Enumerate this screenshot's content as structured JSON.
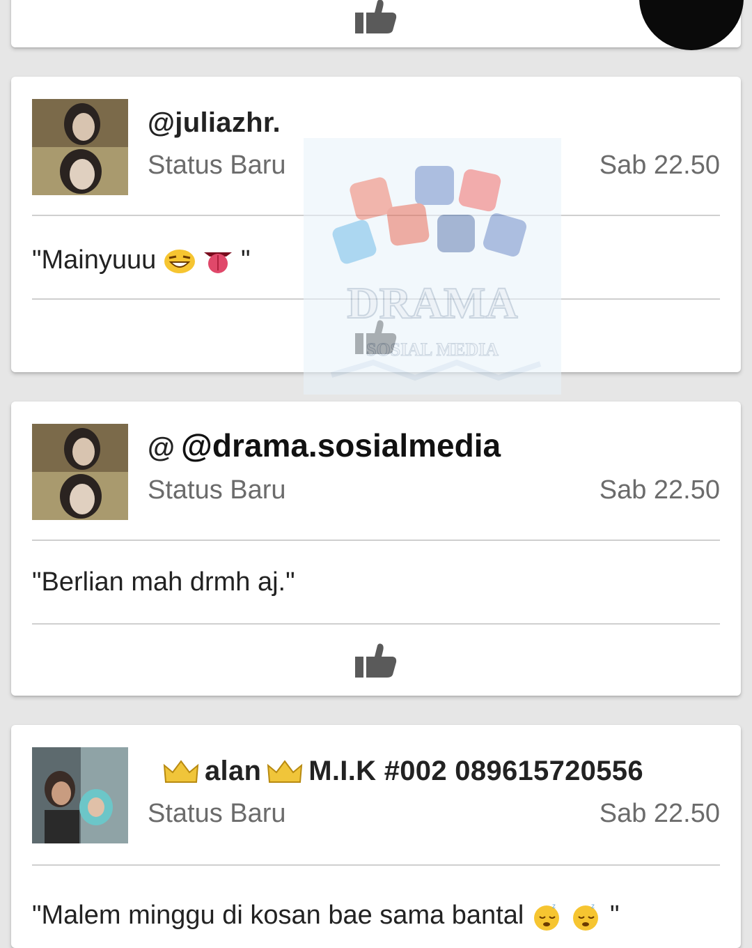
{
  "posts": [
    {
      "username": "@juliazhr.",
      "subtitle": "Status Baru",
      "time": "Sab 22.50",
      "text_before": "\"Mainyuuu",
      "text_after": "\""
    },
    {
      "username": "@",
      "subtitle": "Status Baru",
      "time": "Sab 22.50",
      "text": "\"Berlian mah drmh aj.\""
    },
    {
      "username_part1": "alan",
      "username_part2": "M.I.K #002  089615720556",
      "subtitle": "Status Baru",
      "time": "Sab 22.50",
      "text_before": "\"Malem minggu di kosan bae sama bantal",
      "text_after": "\""
    }
  ],
  "overlay": {
    "handle": "@drama.sosialmedia"
  },
  "watermark": {
    "title": "DRAMA",
    "subtitle": "SOSIAL MEDIA"
  },
  "colors": {
    "background": "#e6e6e6",
    "card": "#ffffff",
    "secondary_text": "#6b6b6b",
    "like_icon": "#5a5a5a"
  },
  "icons": [
    "thumbs-up-icon",
    "crown-icon",
    "laughing-emoji-icon",
    "tongue-emoji-icon",
    "sleeping-emoji-icon"
  ]
}
